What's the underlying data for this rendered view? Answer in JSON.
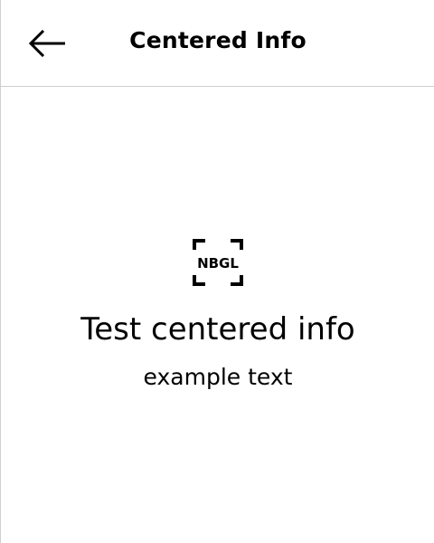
{
  "header": {
    "title": "Centered Info",
    "back_icon": "arrow-left-icon"
  },
  "centered_info": {
    "logo_icon": "nbgl-logo-icon",
    "logo_text": "NBGL",
    "title": "Test centered info",
    "subtitle": "example text"
  },
  "colors": {
    "background": "#ffffff",
    "text": "#000000",
    "divider": "#cfcfcf"
  }
}
